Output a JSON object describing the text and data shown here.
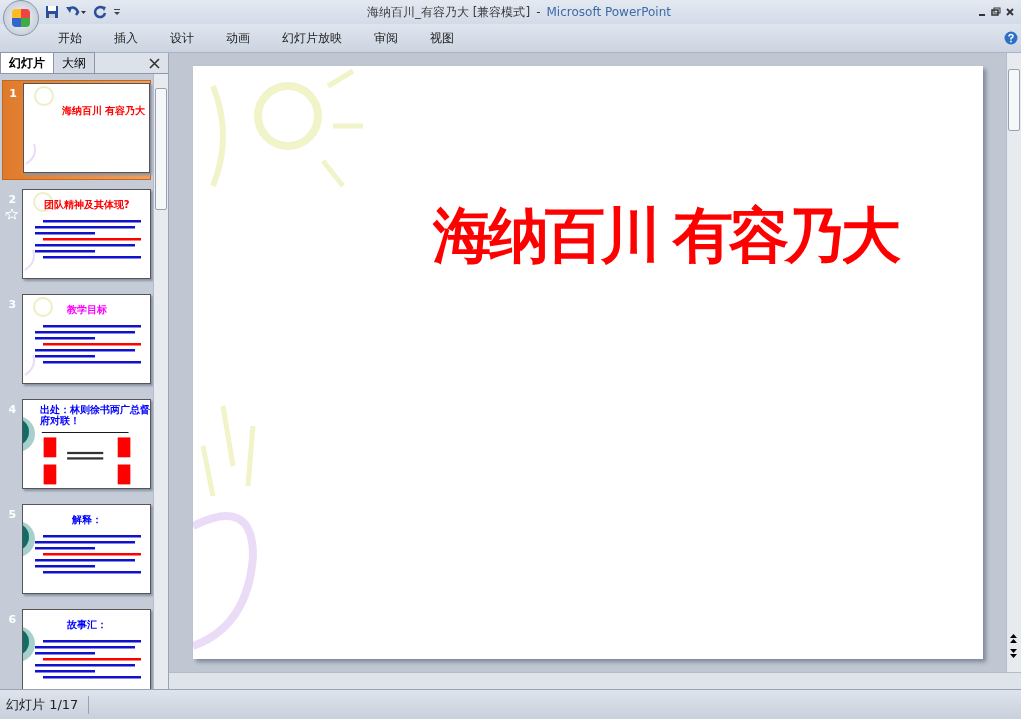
{
  "window": {
    "title": "海纳百川_有容乃大 [兼容模式]",
    "separator": "-",
    "app_name": "Microsoft PowerPoint"
  },
  "ribbon_tabs": [
    "开始",
    "插入",
    "设计",
    "动画",
    "幻灯片放映",
    "审阅",
    "视图"
  ],
  "panel_tabs": [
    {
      "label": "幻灯片",
      "selected": true
    },
    {
      "label": "大纲",
      "selected": false
    }
  ],
  "slides": [
    {
      "number": "1",
      "title": "海纳百川 有容乃大",
      "color": "#ff0000",
      "selected": true,
      "animated": false,
      "kind": "title",
      "circle_decor": false
    },
    {
      "number": "2",
      "title": "团队精神及其体现?",
      "color": "#ff0000",
      "selected": false,
      "animated": true,
      "kind": "text",
      "circle_decor": false
    },
    {
      "number": "3",
      "title": "教学目标",
      "color": "#ff00ff",
      "selected": false,
      "animated": false,
      "kind": "text",
      "circle_decor": false
    },
    {
      "number": "4",
      "title": "出处：林则徐书两广总督府对联！",
      "color": "#0000ff",
      "selected": false,
      "animated": false,
      "kind": "couplet",
      "circle_decor": true
    },
    {
      "number": "5",
      "title": "解释：",
      "color": "#0000ff",
      "selected": false,
      "animated": false,
      "kind": "text",
      "circle_decor": true
    },
    {
      "number": "6",
      "title": "故事汇：",
      "color": "#0000ff",
      "selected": false,
      "animated": false,
      "kind": "text",
      "circle_decor": true
    }
  ],
  "main_slide": {
    "title": "海纳百川 有容乃大"
  },
  "status_bar": {
    "slide_indicator": "幻灯片 1/17"
  }
}
